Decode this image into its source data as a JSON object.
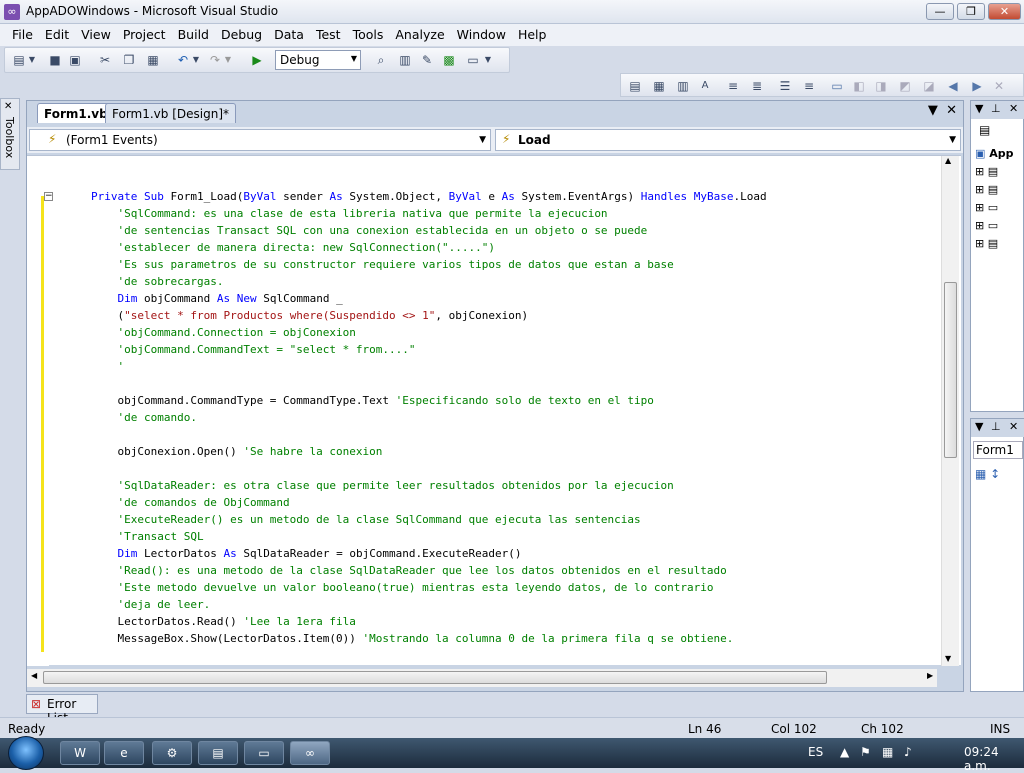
{
  "window": {
    "title": "AppADOWindows - Microsoft Visual Studio",
    "minimize_glyph": "—",
    "restore_glyph": "❐",
    "close_glyph": "✕"
  },
  "menu": [
    "File",
    "Edit",
    "View",
    "Project",
    "Build",
    "Debug",
    "Data",
    "Test",
    "Tools",
    "Analyze",
    "Window",
    "Help"
  ],
  "toolbar": {
    "config": "Debug"
  },
  "toolbox": {
    "label": "Toolbox"
  },
  "editor": {
    "tabs": [
      {
        "label": "Form1.vb*",
        "active": true
      },
      {
        "label": "Form1.vb [Design]*",
        "active": false
      }
    ],
    "object_combo": "(Form1 Events)",
    "member_combo": "Load",
    "lines": [
      [
        {
          "t": "Private Sub ",
          "c": "kw"
        },
        {
          "t": "Form1_Load(",
          "c": ""
        },
        {
          "t": "ByVal ",
          "c": "kw"
        },
        {
          "t": "sender ",
          "c": ""
        },
        {
          "t": "As ",
          "c": "kw"
        },
        {
          "t": "System.Object, ",
          "c": ""
        },
        {
          "t": "ByVal ",
          "c": "kw"
        },
        {
          "t": "e ",
          "c": ""
        },
        {
          "t": "As ",
          "c": "kw"
        },
        {
          "t": "System.EventArgs) ",
          "c": ""
        },
        {
          "t": "Handles ",
          "c": "kw"
        },
        {
          "t": "MyBase",
          "c": "kw"
        },
        {
          "t": ".Load",
          "c": ""
        }
      ],
      [
        {
          "t": "    'SqlCommand: es una clase de esta libreria nativa que permite la ejecucion",
          "c": "cm"
        }
      ],
      [
        {
          "t": "    'de sentencias Transact SQL con una conexion establecida en un objeto o se puede",
          "c": "cm"
        }
      ],
      [
        {
          "t": "    'establecer de manera directa: new SqlConnection(\".....\")",
          "c": "cm"
        }
      ],
      [
        {
          "t": "    'Es sus parametros de su constructor requiere varios tipos de datos que estan a base",
          "c": "cm"
        }
      ],
      [
        {
          "t": "    'de sobrecargas.",
          "c": "cm"
        }
      ],
      [
        {
          "t": "    ",
          "c": ""
        },
        {
          "t": "Dim ",
          "c": "kw"
        },
        {
          "t": "objCommand ",
          "c": ""
        },
        {
          "t": "As New ",
          "c": "kw"
        },
        {
          "t": "SqlCommand _",
          "c": ""
        }
      ],
      [
        {
          "t": "    (",
          "c": ""
        },
        {
          "t": "\"select * from Productos where(Suspendido <> 1\"",
          "c": "st"
        },
        {
          "t": ", objConexion)",
          "c": ""
        }
      ],
      [
        {
          "t": "    'objCommand.Connection = objConexion",
          "c": "cm"
        }
      ],
      [
        {
          "t": "    'objCommand.CommandText = \"select * from....\"",
          "c": "cm"
        }
      ],
      [
        {
          "t": "    '",
          "c": "cm"
        }
      ],
      [
        {
          "t": "",
          "c": ""
        }
      ],
      [
        {
          "t": "    objCommand.CommandType = CommandType.Text ",
          "c": ""
        },
        {
          "t": "'Especificando solo de texto en el tipo",
          "c": "cm"
        }
      ],
      [
        {
          "t": "    'de comando.",
          "c": "cm"
        }
      ],
      [
        {
          "t": "",
          "c": ""
        }
      ],
      [
        {
          "t": "    objConexion.Open() ",
          "c": ""
        },
        {
          "t": "'Se habre la conexion",
          "c": "cm"
        }
      ],
      [
        {
          "t": "",
          "c": ""
        }
      ],
      [
        {
          "t": "    'SqlDataReader: es otra clase que permite leer resultados obtenidos por la ejecucion",
          "c": "cm"
        }
      ],
      [
        {
          "t": "    'de comandos de ObjCommand",
          "c": "cm"
        }
      ],
      [
        {
          "t": "    'ExecuteReader() es un metodo de la clase SqlCommand que ejecuta las sentencias",
          "c": "cm"
        }
      ],
      [
        {
          "t": "    'Transact SQL",
          "c": "cm"
        }
      ],
      [
        {
          "t": "    ",
          "c": ""
        },
        {
          "t": "Dim ",
          "c": "kw"
        },
        {
          "t": "LectorDatos ",
          "c": ""
        },
        {
          "t": "As ",
          "c": "kw"
        },
        {
          "t": "SqlDataReader = objCommand.ExecuteReader()",
          "c": ""
        }
      ],
      [
        {
          "t": "    'Read(): es una metodo de la clase SqlDataReader que lee los datos obtenidos en el resultado",
          "c": "cm"
        }
      ],
      [
        {
          "t": "    'Este metodo devuelve un valor booleano(true) mientras esta leyendo datos, de lo contrario",
          "c": "cm"
        }
      ],
      [
        {
          "t": "    'deja de leer.",
          "c": "cm"
        }
      ],
      [
        {
          "t": "    LectorDatos.Read() ",
          "c": ""
        },
        {
          "t": "'Lee la 1era fila",
          "c": "cm"
        }
      ],
      [
        {
          "t": "    MessageBox.Show(LectorDatos.Item(0)) ",
          "c": ""
        },
        {
          "t": "'Mostrando la columna 0 de la primera fila q se obtiene.",
          "c": "cm"
        }
      ]
    ]
  },
  "solution_explorer": {
    "root": "App"
  },
  "properties": {
    "selected": "Form1"
  },
  "error_list": {
    "label": "Error List"
  },
  "status": {
    "ready": "Ready",
    "ln": "Ln 46",
    "col": "Col 102",
    "ch": "Ch 102",
    "mode": "INS"
  },
  "taskbar": {
    "lang": "ES",
    "clock": "09:24 a.m."
  }
}
